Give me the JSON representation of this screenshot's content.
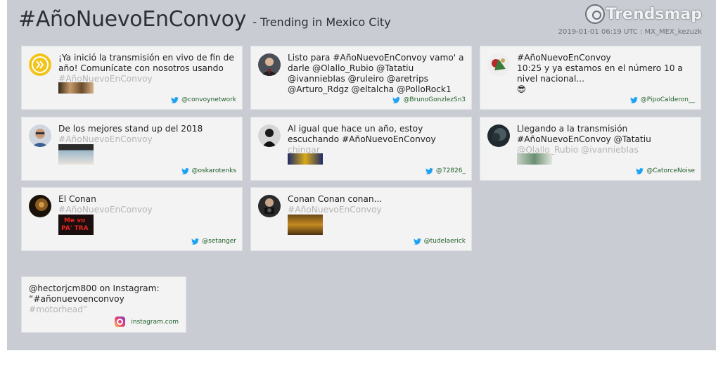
{
  "header": {
    "hashtag": "#AñoNuevoEnConvoy",
    "subtitle": "- Trending in Mexico City",
    "brand": "Trendsmap",
    "meta": "2019-01-01 06:19 UTC : MX_MEX_kezuzk"
  },
  "tweets": [
    {
      "text": "¡Ya inició la transmisión en vivo de fin de año! Comunícate con nosotros usando",
      "fade": "#AñoNuevoEnConvoy",
      "handle": "@convoynetwork",
      "avatar": "convoy-logo",
      "thumb": true
    },
    {
      "text": "Listo para #AñoNuevoEnConvoy vamo' a darle @Olallo_Rubio @Tatatiu @ivanniebIas @ruleiro @aretrips @Arturo_Rdgz @eltalcha @PolloRock1",
      "fade": "",
      "handle": "@BrunoGonzlezSn3",
      "avatar": "man-suit",
      "thumb": false
    },
    {
      "text": "#AñoNuevoEnConvoy\n10:25 y ya estamos en el número 10 a nivel nacional...\n😎",
      "fade": "",
      "handle": "@PipoCalderon__",
      "avatar": "christmas",
      "thumb": false
    },
    {
      "text": "De los mejores stand up del 2018",
      "fade": "#AñoNuevoEnConvoy",
      "handle": "@oskarotenks",
      "avatar": "man-glasses",
      "thumb": true
    },
    {
      "text": "Al igual que hace un año, estoy escuchando #AñoNuevoEnConvoy",
      "fade": "chingar",
      "handle": "@72826_",
      "avatar": "dark-figure",
      "thumb": true
    },
    {
      "text": "Llegando a la transmisión\n#AñoNuevoEnConvoy  @Tatatiu",
      "fade": "@Olallo_Rubio @ivanniebIas",
      "handle": "@CatorceNoise",
      "avatar": "dark-photo",
      "thumb": true
    },
    {
      "text": "El Conan",
      "fade": "#AñoNuevoEnConvoy",
      "handle": "@setanger",
      "avatar": "brown-photo",
      "thumb": true
    },
    {
      "text": "Conan Conan conan...",
      "fade": "#AñoNuevoEnConvoy",
      "handle": "@tudelaerick",
      "avatar": "man-camera",
      "thumb": true
    }
  ],
  "instagram": {
    "text": "@hectorjcm800 on Instagram:\n“#añonuevoenconvoy",
    "fade": "#motorhead”",
    "source": "instagram.com"
  },
  "colors": {
    "panel": "#c9ccd3",
    "card": "#f3f3f3",
    "twitter": "#1da1f2",
    "handle": "#1f5f2a"
  }
}
